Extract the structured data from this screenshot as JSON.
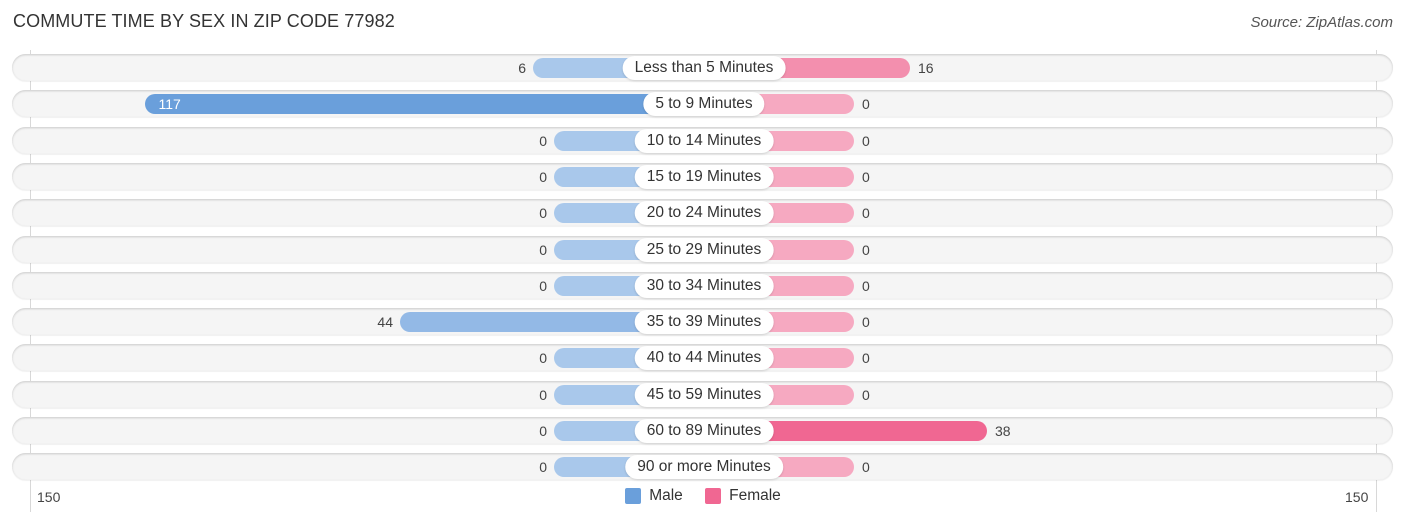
{
  "title": "COMMUTE TIME BY SEX IN ZIP CODE 77982",
  "source": "Source: ZipAtlas.com",
  "colors": {
    "male": "#a9c8eb",
    "male_strong": "#6a9fdb",
    "female": "#f6a9c1",
    "female_strong": "#f06792",
    "track": "#f5f5f5"
  },
  "legend": [
    {
      "label": "Male",
      "color": "#6a9fdb"
    },
    {
      "label": "Female",
      "color": "#f06792"
    }
  ],
  "axis": {
    "left_tick": "150",
    "right_tick": "150"
  },
  "chart_data": {
    "type": "bar",
    "orientation": "horizontal-diverging",
    "title": "COMMUTE TIME BY SEX IN ZIP CODE 77982",
    "xlabel": "",
    "ylabel": "",
    "xlim": [
      -150,
      150
    ],
    "legend_position": "bottom-center",
    "categories": [
      "Less than 5 Minutes",
      "5 to 9 Minutes",
      "10 to 14 Minutes",
      "15 to 19 Minutes",
      "20 to 24 Minutes",
      "25 to 29 Minutes",
      "30 to 34 Minutes",
      "35 to 39 Minutes",
      "40 to 44 Minutes",
      "45 to 59 Minutes",
      "60 to 89 Minutes",
      "90 or more Minutes"
    ],
    "series": [
      {
        "name": "Male",
        "values": [
          6,
          117,
          0,
          0,
          0,
          0,
          0,
          44,
          0,
          0,
          0,
          0
        ]
      },
      {
        "name": "Female",
        "values": [
          16,
          0,
          0,
          0,
          0,
          0,
          0,
          0,
          0,
          0,
          38,
          0
        ]
      }
    ],
    "tick_labels": [
      "150",
      "150"
    ]
  }
}
